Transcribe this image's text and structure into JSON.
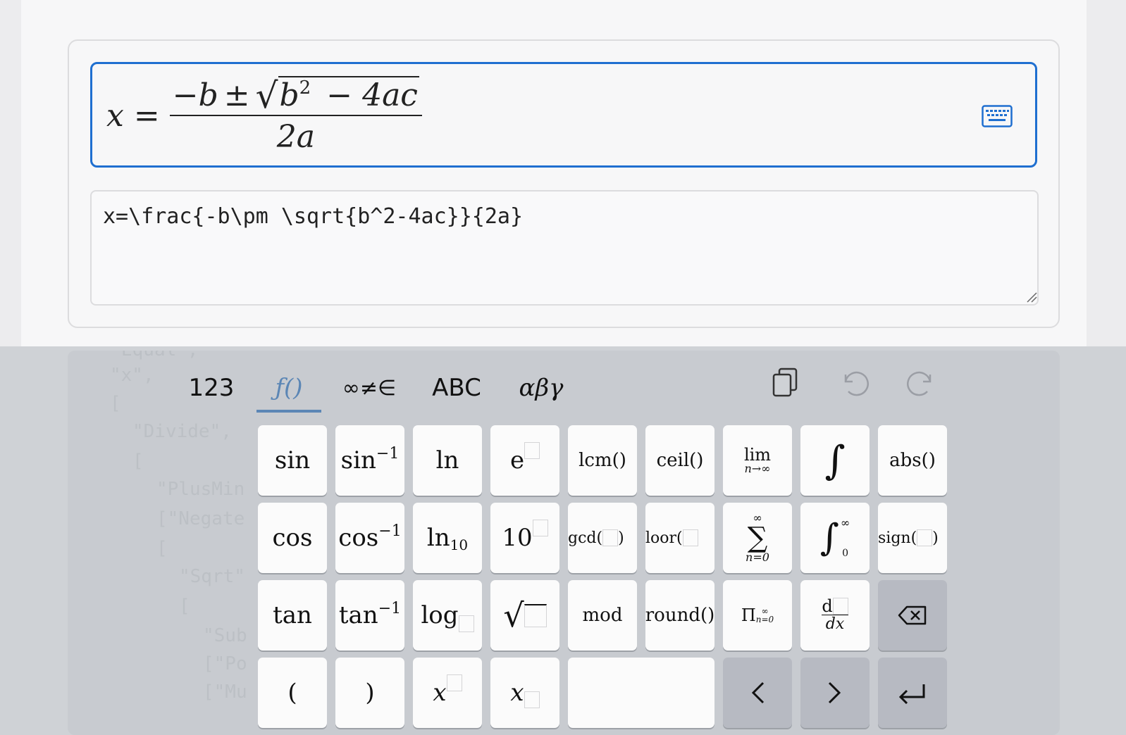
{
  "editor": {
    "formula": {
      "lhs": "x",
      "eq": "=",
      "numerator_neg_b": "−b",
      "pm": "±",
      "radicand_b": "b",
      "radicand_exp": "2",
      "radicand_rest": "− 4ac",
      "denominator": "2a"
    },
    "latex_value": "x=\\frac{-b\\pm \\sqrt{b^2-4ac}}{2a}",
    "keyboard_toggle_icon": "keyboard-icon"
  },
  "background_json": [
    "Equal\",",
    "\"x\",",
    "[",
    "\"Divide\",",
    "[",
    "\"PlusMin",
    "[\"Negate",
    "[",
    "\"Sqrt\"",
    "[",
    "\"Sub",
    "[\"Po",
    "[\"Mu"
  ],
  "keyboard": {
    "tabs": [
      {
        "label": "123"
      },
      {
        "label": "ƒ()"
      },
      {
        "label": "∞≠∈"
      },
      {
        "label": "ABC"
      },
      {
        "label": "αβγ"
      }
    ],
    "active_tab": "ƒ()",
    "actions": {
      "copy": "copy-icon",
      "undo": "undo-icon",
      "redo": "redo-icon"
    },
    "keys": {
      "sin": "sin",
      "arcsin": "sin",
      "inv": "−1",
      "ln": "ln",
      "e": "e",
      "lcm": "lcm()",
      "ceil": "ceil()",
      "lim": "lim",
      "lim_sub": "n→∞",
      "integral": "∫",
      "abs": "abs()",
      "cos": "cos",
      "arccos": "cos",
      "ln10": "ln",
      "ln10_sub": "10",
      "ten": "10",
      "gcd": "gcd(",
      "gcd_close": ")",
      "floor": "loor(",
      "sum_top": "∞",
      "sum": "∑",
      "sum_bottom": "n=0",
      "defint": "∫",
      "defint_top": "∞",
      "defint_bottom": "0",
      "sign": "sign(",
      "sign_close": ")",
      "tan": "tan",
      "arctan": "tan",
      "log": "log",
      "sqrt": "√",
      "mod": "mod",
      "round": "round()",
      "prod": "Π",
      "prod_sub": "n=0",
      "prod_sup": "∞",
      "deriv_num": "d",
      "deriv_den": "dx",
      "lparen": "(",
      "rparen": ")",
      "x_sup": "x",
      "x_sub": "x",
      "left": "<",
      "right": ">"
    }
  }
}
